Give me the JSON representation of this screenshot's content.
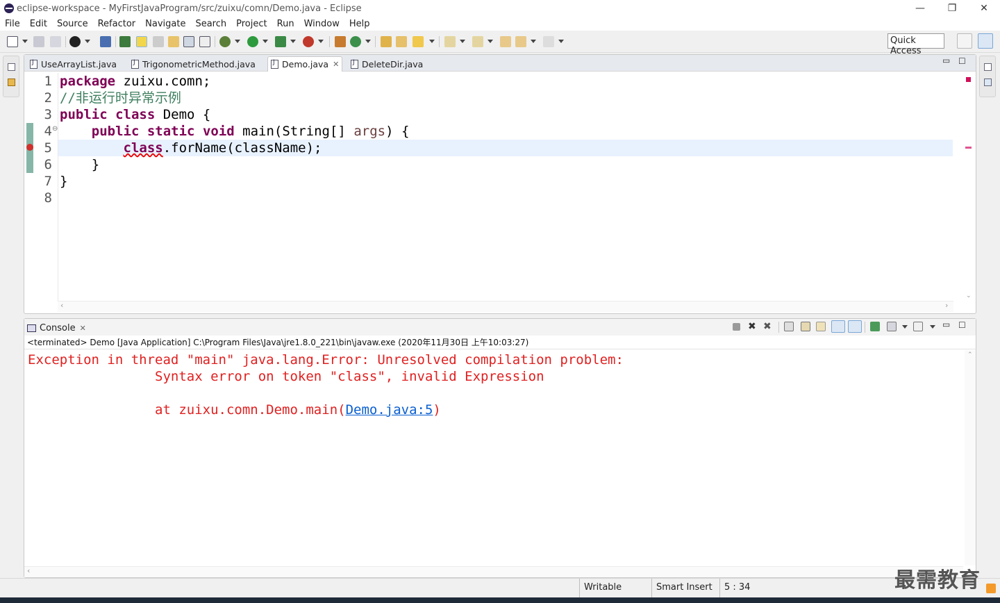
{
  "window": {
    "title": "eclipse-workspace - MyFirstJavaProgram/src/zuixu/comn/Demo.java - Eclipse",
    "controls": {
      "minimize": "—",
      "restore": "❐",
      "close": "✕"
    }
  },
  "menubar": [
    "File",
    "Edit",
    "Source",
    "Refactor",
    "Navigate",
    "Search",
    "Project",
    "Run",
    "Window",
    "Help"
  ],
  "toolbar": {
    "quick_access": "Quick Access"
  },
  "editor": {
    "tabs": [
      {
        "label": "UseArrayList.java",
        "active": false
      },
      {
        "label": "TrigonometricMethod.java",
        "active": false
      },
      {
        "label": "Demo.java",
        "active": true,
        "close": "✕"
      },
      {
        "label": "DeleteDir.java",
        "active": false
      }
    ],
    "line_numbers": [
      "1",
      "2",
      "3",
      "4",
      "5",
      "6",
      "7",
      "8"
    ],
    "fold_marker": "⊖",
    "code": {
      "l1_kw": "package",
      "l1_rest": " zuixu.comn;",
      "l2_comment": "//非运行时异常示例",
      "l3_kw1": "public",
      "l3_kw2": "class",
      "l3_rest": " Demo {",
      "l4_indent": "    ",
      "l4_kw1": "public",
      "l4_kw2": "static",
      "l4_kw3": "void",
      "l4_mid": " main(String[] ",
      "l4_param": "args",
      "l4_end": ") {",
      "l5_indent": "        ",
      "l5_kw": "class",
      "l5_rest": ".forName(className);",
      "l6": "    }",
      "l7": "}"
    }
  },
  "console": {
    "tab_label": "Console",
    "tab_close": "✕",
    "status": "<terminated> Demo [Java Application] C:\\Program Files\\Java\\jre1.8.0_221\\bin\\javaw.exe (2020年11月30日 上午10:03:27)",
    "lines": {
      "l1": "Exception in thread \"main\" java.lang.Error: Unresolved compilation problem: ",
      "l2": "\tSyntax error on token \"class\", invalid Expression",
      "l3_prefix": "\tat zuixu.comn.Demo.main(",
      "l3_link": "Demo.java:5",
      "l3_suffix": ")"
    }
  },
  "statusbar": {
    "writable": "Writable",
    "insert_mode": "Smart Insert",
    "position": "5 : 34"
  },
  "watermark": "最需教育",
  "colors": {
    "keyword": "#7f0055",
    "comment": "#3f7f5f",
    "error_text": "#e02020",
    "link": "#0a5fd0",
    "current_line": "#e8f2fe"
  }
}
